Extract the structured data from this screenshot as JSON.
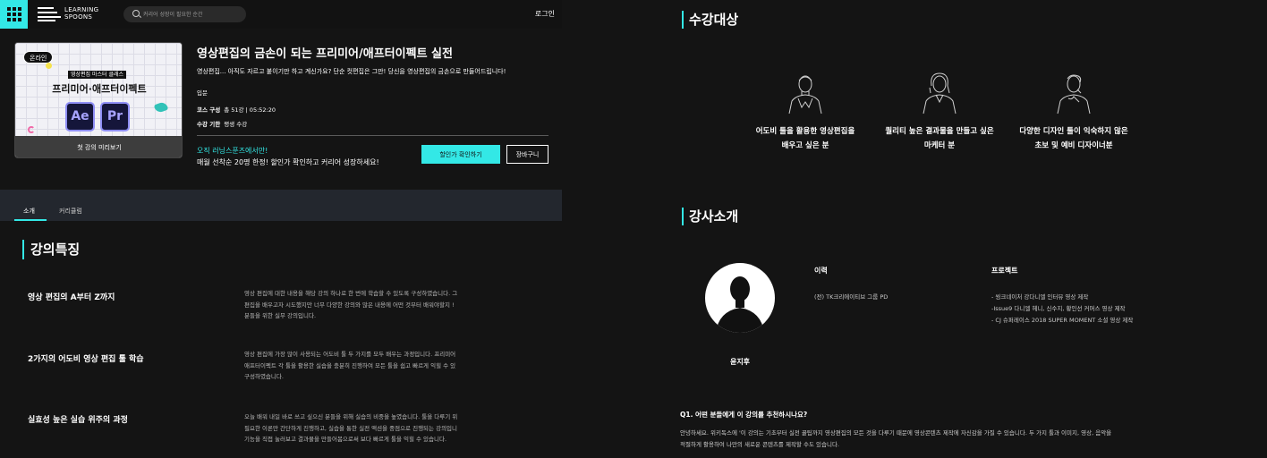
{
  "header": {
    "logo_line1": "LEARNING",
    "logo_line2": "SPOONS",
    "search_placeholder": "커리어 성장이 필요한 순간",
    "login_label": "로그인"
  },
  "hero": {
    "thumbnail": {
      "badge": "온라인",
      "subtitle": "영상편집 마스터 클래스",
      "title": "프리미어·애프터이펙트",
      "app1": "Ae",
      "app2": "Pr",
      "preview_label": "첫 강의 미리보기"
    },
    "title": "영상편집의 금손이 되는 프리미어/애프터이펙트 실전",
    "description": "영상편집... 아직도 자르고 붙이기만 하고 계신가요? 단순 컷편집은 그만! 당신을 영상편집의 금손으로 만들어드립니다!",
    "level": "입문",
    "composition_label": "코스 구성",
    "composition_value": "총 51강 | 05:52:20",
    "period_label": "수강 기한",
    "period_value": "평생 수강",
    "promo_line1": "오직 러닝스푼즈에서만!",
    "promo_line2": "매월 선착순 20명 한정! 할인가 확인하고 커리어 성장하세요!",
    "discount_button": "할인가 확인하기",
    "cart_button": "장바구니"
  },
  "tabs": [
    {
      "label": "소개"
    },
    {
      "label": "커리큘럼"
    }
  ],
  "features": {
    "heading": "강의특징",
    "items": [
      {
        "title": "영상 편집의 A부터 Z까지",
        "lines": [
          "영상 편집에 대한 내용을 해당 강의 하나로 한 번에 학습할 수 있도록 구성하였습니다. 그",
          "편집을 배우고자 시도했지만 너무 다양한 강의와 많은 내용에 어떤 것부터 배워야할지 !",
          "분들을 위한 실무 강의입니다."
        ]
      },
      {
        "title": "2가지의 어도비 영상 편집 툴 학습",
        "lines": [
          "영상 편집에 가장 많이 사용되는 어도비 툴 두 가지를 모두 배우는 과정입니다. 프리미어",
          "애프터이펙트 각 툴을 활용한 실습을 충분히 진행하여 모든 툴을 쉽고 빠르게 익힐 수 있",
          "구성하였습니다."
        ]
      },
      {
        "title": "실효성 높은 실습 위주의 과정",
        "lines": [
          "오늘 배워 내일 바로 쓰고 싶으신 분들을 위해 실습의 비중을 높였습니다. 툴을 다루기 위",
          "필요한 이론만 간단하게 진행하고, 실습을 통한 실전 액션을 중점으로 진행되는 강의입니",
          "기능을 직접 눌러보고 결과물을 만들어봄으로써 보다 빠르게 툴을 익힐 수 있습니다."
        ]
      }
    ]
  },
  "target": {
    "heading": "수강대상",
    "items": [
      {
        "line1": "어도비 툴을 활용한 영상편집을",
        "line2": "배우고 싶은 분"
      },
      {
        "line1": "퀄리티 높은 결과물을 만들고 싶은",
        "line2": "마케터 분"
      },
      {
        "line1": "다양한 디자인 툴이 익숙하지 않은",
        "line2": "초보 및 예비 디자이너분"
      }
    ]
  },
  "instructor": {
    "heading": "강사소개",
    "name": "윤지후",
    "career_label": "이력",
    "career_items": [
      "(전) TK크리에이티브 그룹 PD"
    ],
    "project_label": "프로젝트",
    "project_items": [
      "- 씽크네이처 강다니엘 인터뷰 영상 제작",
      "-Issue9 다니엘 헤니, 신수지, 황인선 커머스 영상 제작",
      "- CJ 슈퍼레이스 2018 SUPER MOMENT 소셜 영상 제작"
    ]
  },
  "faq": {
    "question": "Q1. 어떤 분들에게 이 강의를 추천하시나요?",
    "answer_lines": [
      "안녕하세요. 위키독스에 '이 강의는 기초부터 실전 꿀팁까지 영상편집의 모든 것을 다루기 때문에 영상콘텐츠 제작에 자신감을 가질 수 있습니다. 두 가지 툴과 이미지, 영상, 음악을",
      "적절하게 활용하여 나만의 새로운 콘텐츠를 제작할 수도 있습니다."
    ]
  },
  "colors": {
    "accent": "#33e8e6",
    "background": "#141414",
    "tabbar": "#23272e"
  },
  "icons": [
    "menu-grid-icon",
    "search-icon",
    "person-line-icon",
    "avatar-silhouette-icon",
    "adobe-aftereffects-icon",
    "adobe-premiere-icon"
  ]
}
